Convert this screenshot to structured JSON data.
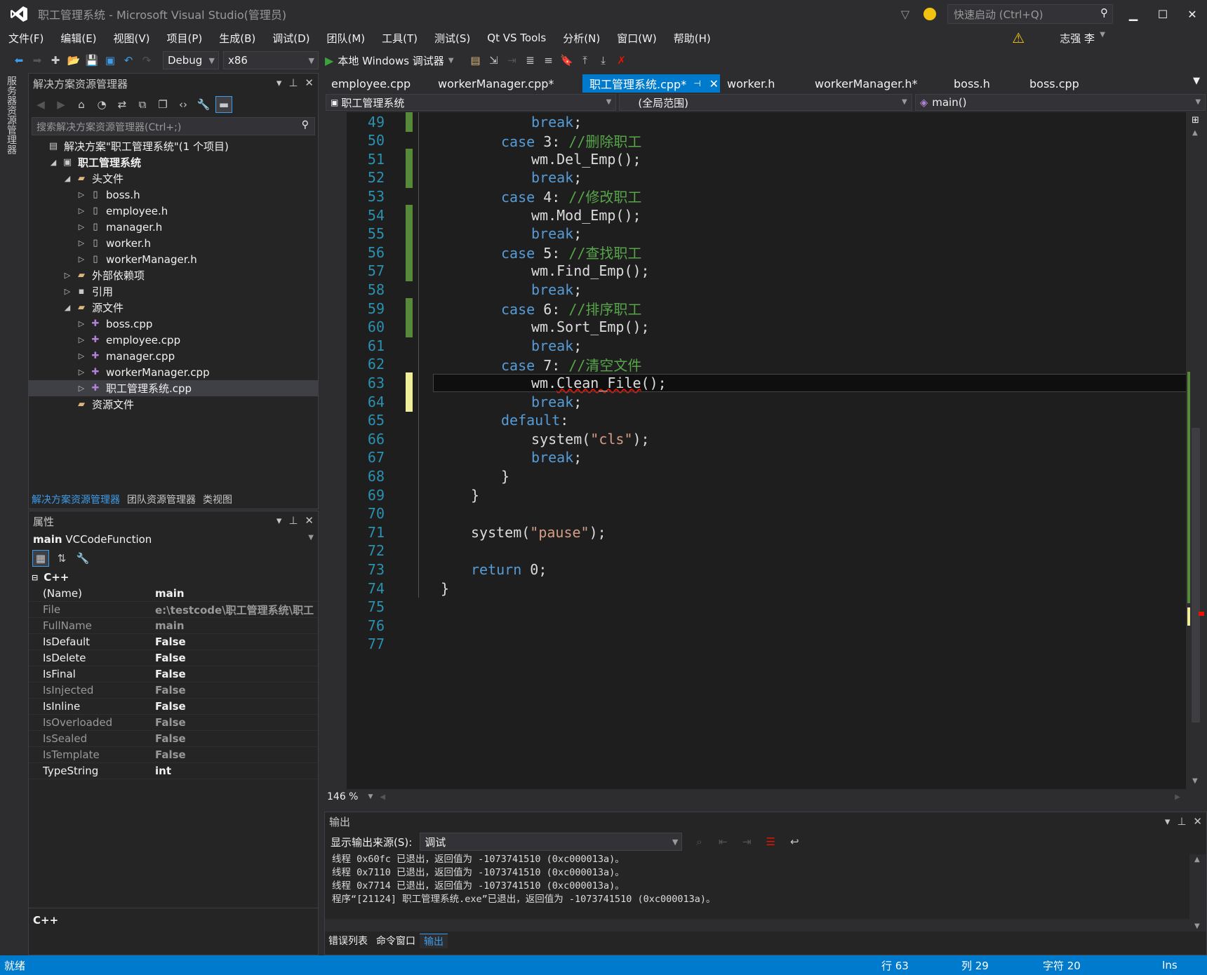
{
  "window": {
    "title": "职工管理系统 - Microsoft Visual Studio(管理员)",
    "quick_launch_placeholder": "快速启动 (Ctrl+Q)",
    "user": "志强 李"
  },
  "menu": [
    "文件(F)",
    "编辑(E)",
    "视图(V)",
    "项目(P)",
    "生成(B)",
    "调试(D)",
    "团队(M)",
    "工具(T)",
    "测试(S)",
    "Qt VS Tools",
    "分析(N)",
    "窗口(W)",
    "帮助(H)"
  ],
  "toolbar": {
    "config": "Debug",
    "platform": "x86",
    "run_label": "本地 Windows 调试器"
  },
  "side_strip": {
    "label": "服务器资源管理器"
  },
  "solution_explorer": {
    "title": "解决方案资源管理器",
    "search_placeholder": "搜索解决方案资源管理器(Ctrl+;)",
    "nodes": [
      {
        "label": "解决方案\"职工管理系统\"(1 个项目)",
        "level": 0,
        "expander": "",
        "icon": "solution-icon"
      },
      {
        "label": "职工管理系统",
        "level": 1,
        "expander": "◢",
        "icon": "project-icon",
        "bold": true
      },
      {
        "label": "头文件",
        "level": 2,
        "expander": "◢",
        "icon": "folder-icon"
      },
      {
        "label": "boss.h",
        "level": 3,
        "expander": "▷",
        "icon": "header-file-icon"
      },
      {
        "label": "employee.h",
        "level": 3,
        "expander": "▷",
        "icon": "header-file-icon"
      },
      {
        "label": "manager.h",
        "level": 3,
        "expander": "▷",
        "icon": "header-file-icon"
      },
      {
        "label": "worker.h",
        "level": 3,
        "expander": "▷",
        "icon": "header-file-icon"
      },
      {
        "label": "workerManager.h",
        "level": 3,
        "expander": "▷",
        "icon": "header-file-icon"
      },
      {
        "label": "外部依赖项",
        "level": 2,
        "expander": "▷",
        "icon": "folder-icon"
      },
      {
        "label": "引用",
        "level": 2,
        "expander": "▷",
        "icon": "reference-icon"
      },
      {
        "label": "源文件",
        "level": 2,
        "expander": "◢",
        "icon": "folder-icon"
      },
      {
        "label": "boss.cpp",
        "level": 3,
        "expander": "▷",
        "icon": "cpp-file-icon"
      },
      {
        "label": "employee.cpp",
        "level": 3,
        "expander": "▷",
        "icon": "cpp-file-icon"
      },
      {
        "label": "manager.cpp",
        "level": 3,
        "expander": "▷",
        "icon": "cpp-file-icon"
      },
      {
        "label": "workerManager.cpp",
        "level": 3,
        "expander": "▷",
        "icon": "cpp-file-icon"
      },
      {
        "label": "职工管理系统.cpp",
        "level": 3,
        "expander": "▷",
        "icon": "cpp-file-icon",
        "selected": true
      },
      {
        "label": "资源文件",
        "level": 2,
        "expander": "",
        "icon": "folder-icon"
      }
    ],
    "tabs": [
      {
        "label": "解决方案资源管理器",
        "active": true
      },
      {
        "label": "团队资源管理器"
      },
      {
        "label": "类视图"
      }
    ]
  },
  "properties": {
    "title": "属性",
    "object_name": "main",
    "object_type": "VCCodeFunction",
    "category": "C++",
    "rows": [
      {
        "key": "(Name)",
        "value": "main",
        "dim": false
      },
      {
        "key": "File",
        "value": "e:\\testcode\\职工管理系统\\职工",
        "dim": true
      },
      {
        "key": "FullName",
        "value": "main",
        "dim": true
      },
      {
        "key": "IsDefault",
        "value": "False",
        "dim": false
      },
      {
        "key": "IsDelete",
        "value": "False",
        "dim": false
      },
      {
        "key": "IsFinal",
        "value": "False",
        "dim": false
      },
      {
        "key": "IsInjected",
        "value": "False",
        "dim": true
      },
      {
        "key": "IsInline",
        "value": "False",
        "dim": false
      },
      {
        "key": "IsOverloaded",
        "value": "False",
        "dim": true
      },
      {
        "key": "IsSealed",
        "value": "False",
        "dim": true
      },
      {
        "key": "IsTemplate",
        "value": "False",
        "dim": true
      },
      {
        "key": "TypeString",
        "value": "int",
        "dim": false
      }
    ],
    "description_title": "C++"
  },
  "doc_tabs": [
    {
      "label": "employee.cpp"
    },
    {
      "label": "workerManager.cpp*"
    },
    {
      "label": "职工管理系统.cpp*",
      "active": true
    },
    {
      "label": "worker.h"
    },
    {
      "label": "workerManager.h*"
    },
    {
      "label": "boss.h"
    },
    {
      "label": "boss.cpp"
    }
  ],
  "nav": {
    "project": "职工管理系统",
    "scope": "(全局范围)",
    "member": "main()"
  },
  "code_lines": [
    {
      "n": "49",
      "ind": 6,
      "tokens": [
        {
          "c": "kw",
          "t": "break"
        },
        {
          "c": "tx",
          "t": ";"
        }
      ],
      "chg": "green"
    },
    {
      "n": "50",
      "ind": 4,
      "tokens": [
        {
          "c": "kw",
          "t": "case"
        },
        {
          "c": "tx",
          "t": " 3: "
        },
        {
          "c": "cm",
          "t": "//删除职工"
        }
      ],
      "chg": ""
    },
    {
      "n": "51",
      "ind": 6,
      "tokens": [
        {
          "c": "tx",
          "t": "wm.Del_Emp();"
        }
      ],
      "chg": "green"
    },
    {
      "n": "52",
      "ind": 6,
      "tokens": [
        {
          "c": "kw",
          "t": "break"
        },
        {
          "c": "tx",
          "t": ";"
        }
      ],
      "chg": "green"
    },
    {
      "n": "53",
      "ind": 4,
      "tokens": [
        {
          "c": "kw",
          "t": "case"
        },
        {
          "c": "tx",
          "t": " 4: "
        },
        {
          "c": "cm",
          "t": "//修改职工"
        }
      ],
      "chg": ""
    },
    {
      "n": "54",
      "ind": 6,
      "tokens": [
        {
          "c": "tx",
          "t": "wm.Mod_Emp();"
        }
      ],
      "chg": "green"
    },
    {
      "n": "55",
      "ind": 6,
      "tokens": [
        {
          "c": "kw",
          "t": "break"
        },
        {
          "c": "tx",
          "t": ";"
        }
      ],
      "chg": "green"
    },
    {
      "n": "56",
      "ind": 4,
      "tokens": [
        {
          "c": "kw",
          "t": "case"
        },
        {
          "c": "tx",
          "t": " 5: "
        },
        {
          "c": "cm",
          "t": "//查找职工"
        }
      ],
      "chg": "green"
    },
    {
      "n": "57",
      "ind": 6,
      "tokens": [
        {
          "c": "tx",
          "t": "wm.Find_Emp();"
        }
      ],
      "chg": "green"
    },
    {
      "n": "58",
      "ind": 6,
      "tokens": [
        {
          "c": "kw",
          "t": "break"
        },
        {
          "c": "tx",
          "t": ";"
        }
      ],
      "chg": ""
    },
    {
      "n": "59",
      "ind": 4,
      "tokens": [
        {
          "c": "kw",
          "t": "case"
        },
        {
          "c": "tx",
          "t": " 6: "
        },
        {
          "c": "cm",
          "t": "//排序职工"
        }
      ],
      "chg": "green"
    },
    {
      "n": "60",
      "ind": 6,
      "tokens": [
        {
          "c": "tx",
          "t": "wm.Sort_Emp();"
        }
      ],
      "chg": "green"
    },
    {
      "n": "61",
      "ind": 6,
      "tokens": [
        {
          "c": "kw",
          "t": "break"
        },
        {
          "c": "tx",
          "t": ";"
        }
      ],
      "chg": ""
    },
    {
      "n": "62",
      "ind": 4,
      "tokens": [
        {
          "c": "kw",
          "t": "case"
        },
        {
          "c": "tx",
          "t": " 7: "
        },
        {
          "c": "cm",
          "t": "//清空文件"
        }
      ],
      "chg": ""
    },
    {
      "n": "63",
      "ind": 6,
      "tokens": [
        {
          "c": "tx",
          "t": "wm."
        },
        {
          "c": "err",
          "t": "Clean_File"
        },
        {
          "c": "tx",
          "t": "();"
        }
      ],
      "chg": "yellow",
      "current": true
    },
    {
      "n": "64",
      "ind": 6,
      "tokens": [
        {
          "c": "kw",
          "t": "break"
        },
        {
          "c": "tx",
          "t": ";"
        }
      ],
      "chg": "yellow"
    },
    {
      "n": "65",
      "ind": 4,
      "tokens": [
        {
          "c": "kw",
          "t": "default"
        },
        {
          "c": "tx",
          "t": ":"
        }
      ],
      "chg": ""
    },
    {
      "n": "66",
      "ind": 6,
      "tokens": [
        {
          "c": "tx",
          "t": "system("
        },
        {
          "c": "st",
          "t": "\"cls\""
        },
        {
          "c": "tx",
          "t": ");"
        }
      ],
      "chg": ""
    },
    {
      "n": "67",
      "ind": 6,
      "tokens": [
        {
          "c": "kw",
          "t": "break"
        },
        {
          "c": "tx",
          "t": ";"
        }
      ],
      "chg": ""
    },
    {
      "n": "68",
      "ind": 4,
      "tokens": [
        {
          "c": "tx",
          "t": "}"
        }
      ],
      "chg": ""
    },
    {
      "n": "69",
      "ind": 2,
      "tokens": [
        {
          "c": "tx",
          "t": "}"
        }
      ],
      "chg": ""
    },
    {
      "n": "70",
      "ind": 0,
      "tokens": [],
      "chg": ""
    },
    {
      "n": "71",
      "ind": 2,
      "tokens": [
        {
          "c": "tx",
          "t": "system("
        },
        {
          "c": "st",
          "t": "\"pause\""
        },
        {
          "c": "tx",
          "t": ");"
        }
      ],
      "chg": ""
    },
    {
      "n": "72",
      "ind": 0,
      "tokens": [],
      "chg": ""
    },
    {
      "n": "73",
      "ind": 2,
      "tokens": [
        {
          "c": "kw",
          "t": "return"
        },
        {
          "c": "tx",
          "t": " 0;"
        }
      ],
      "chg": ""
    },
    {
      "n": "74",
      "ind": 0,
      "tokens": [
        {
          "c": "tx",
          "t": "}"
        }
      ],
      "chg": ""
    },
    {
      "n": "75",
      "ind": 0,
      "tokens": [],
      "chg": ""
    },
    {
      "n": "76",
      "ind": 0,
      "tokens": [],
      "chg": ""
    },
    {
      "n": "77",
      "ind": 0,
      "tokens": [],
      "chg": ""
    }
  ],
  "zoom": "146 %",
  "output": {
    "title": "输出",
    "source_label": "显示输出来源(S):",
    "source_value": "调试",
    "lines": [
      "线程 0x60fc 已退出，返回值为 -1073741510 (0xc000013a)。",
      "线程 0x7110 已退出，返回值为 -1073741510 (0xc000013a)。",
      "线程 0x7714 已退出，返回值为 -1073741510 (0xc000013a)。",
      "程序“[21124] 职工管理系统.exe”已退出，返回值为 -1073741510 (0xc000013a)。"
    ]
  },
  "bottom_tabs": [
    {
      "label": "错误列表"
    },
    {
      "label": "命令窗口"
    },
    {
      "label": "输出",
      "active": true
    }
  ],
  "status": {
    "ready": "就绪",
    "line": "行 63",
    "col": "列 29",
    "ch": "字符 20",
    "mode": "Ins"
  },
  "colors": {
    "accent": "#007acc",
    "keyword": "#569cd6",
    "comment": "#57a64a",
    "string": "#d69d85",
    "line_number": "#2b91af",
    "change_green": "#57893b",
    "change_yellow": "#efef9a"
  }
}
